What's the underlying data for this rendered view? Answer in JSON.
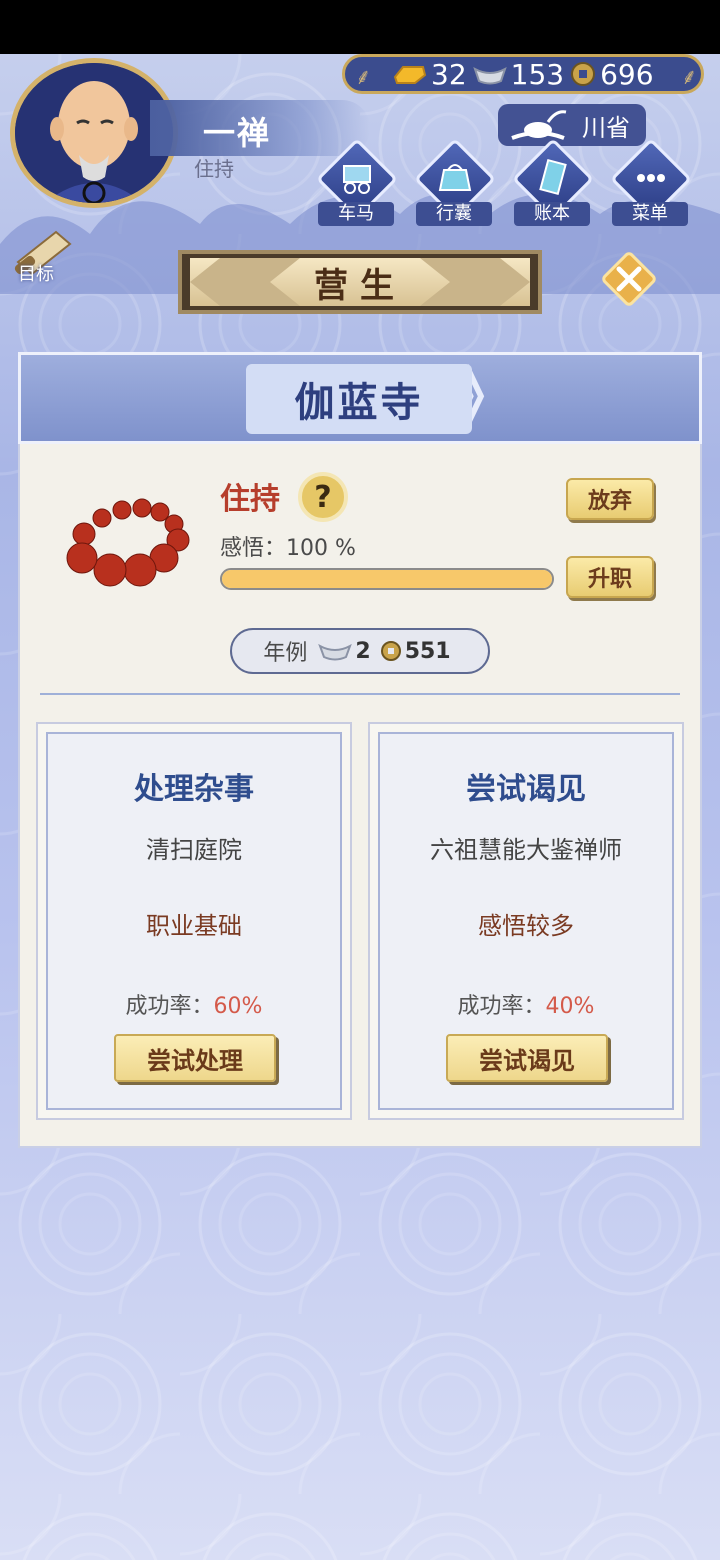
{
  "header": {
    "player_name": "一禅",
    "player_title": "住持",
    "currency": {
      "gold": "32",
      "silver": "153",
      "copper": "696"
    },
    "province": "川省",
    "nav": [
      {
        "label": "车马",
        "icon": "carriage-icon"
      },
      {
        "label": "行囊",
        "icon": "bag-icon"
      },
      {
        "label": "账本",
        "icon": "ledger-icon"
      },
      {
        "label": "菜单",
        "icon": "menu-dots-icon"
      }
    ],
    "target_label": "目标"
  },
  "banner": {
    "title": "营生"
  },
  "temple": {
    "name": "伽蓝寺",
    "job_title": "住持",
    "help": "?",
    "insight_label": "感悟：",
    "insight_value": "100 %",
    "insight_fraction": 1.0,
    "abandon_label": "放弃",
    "promote_label": "升职",
    "salary_label": "年例",
    "salary_silver": "2",
    "salary_copper": "551"
  },
  "actions": [
    {
      "title": "处理杂事",
      "subject": "清扫庭院",
      "trait": "职业基础",
      "rate_label": "成功率：",
      "rate": "60%",
      "button": "尝试处理"
    },
    {
      "title": "尝试谒见",
      "subject": "六祖慧能大鉴禅师",
      "trait": "感悟较多",
      "rate_label": "成功率：",
      "rate": "40%",
      "button": "尝试谒见"
    }
  ]
}
